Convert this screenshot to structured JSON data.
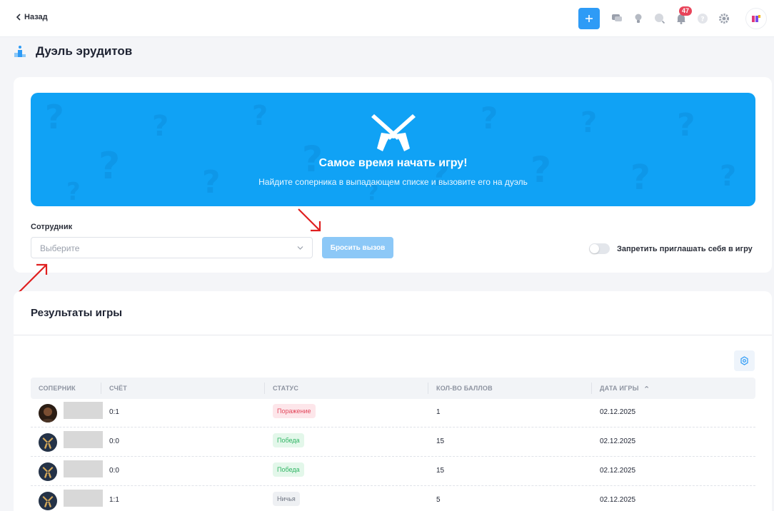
{
  "topbar": {
    "back_label": "Назад",
    "notifications_count": "47",
    "icons": [
      "plus-icon",
      "chat-icon",
      "lightbulb-icon",
      "search-icon",
      "bell-icon",
      "help-icon",
      "gear-icon",
      "app-logo-icon"
    ]
  },
  "page": {
    "title": "Дуэль эрудитов"
  },
  "banner": {
    "title": "Самое время начать игру!",
    "subtitle": "Найдите соперника в выпадающем списке и вызовите его на дуэль",
    "color": "#10a2f5"
  },
  "form": {
    "employee_label": "Сотрудник",
    "employee_placeholder": "Выберите",
    "challenge_button": "Бросить вызов",
    "block_invites_label": "Запретить приглашать себя в игру",
    "block_invites_on": false
  },
  "results": {
    "title": "Результаты игры",
    "columns": [
      "СОПЕРНИК",
      "СЧЁТ",
      "СТАТУС",
      "КОЛ-ВО БАЛЛОВ",
      "ДАТА ИГРЫ"
    ],
    "sort_indicator": "⌃",
    "rows": [
      {
        "score": "0:1",
        "status": "Поражение",
        "status_type": "lose",
        "points": "1",
        "date": "02.12.2025",
        "avatar": "photo"
      },
      {
        "score": "0:0",
        "status": "Победа",
        "status_type": "win",
        "points": "15",
        "date": "02.12.2025",
        "avatar": "guns"
      },
      {
        "score": "0:0",
        "status": "Победа",
        "status_type": "win",
        "points": "15",
        "date": "02.12.2025",
        "avatar": "guns"
      },
      {
        "score": "1:1",
        "status": "Ничья",
        "status_type": "draw",
        "points": "5",
        "date": "02.12.2025",
        "avatar": "guns"
      }
    ]
  },
  "colors": {
    "accent": "#2e9bf6",
    "lose": "#e2485c",
    "win": "#2fb463",
    "annotation": "#e02020"
  }
}
